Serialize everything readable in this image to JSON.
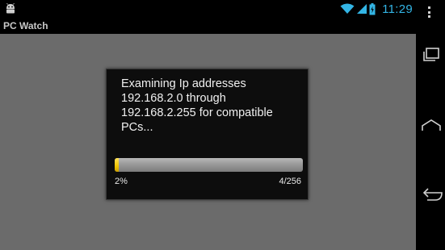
{
  "app": {
    "title": "PC Watch"
  },
  "status_bar": {
    "time": "11:29",
    "icons": [
      "android-icon",
      "wifi-icon",
      "signal-icon",
      "battery-icon"
    ],
    "time_color": "#33b5e5"
  },
  "dialog": {
    "message": "Examining Ip addresses 192.168.2.0 through 192.168.2.255 for compatible PCs...",
    "progress": {
      "percent_label": "2%",
      "count_label": "4/256",
      "fraction": 0.02,
      "fill_color": "#f0c400"
    }
  },
  "navigation": {
    "buttons": [
      "recent-apps-icon",
      "home-icon",
      "back-icon"
    ]
  }
}
